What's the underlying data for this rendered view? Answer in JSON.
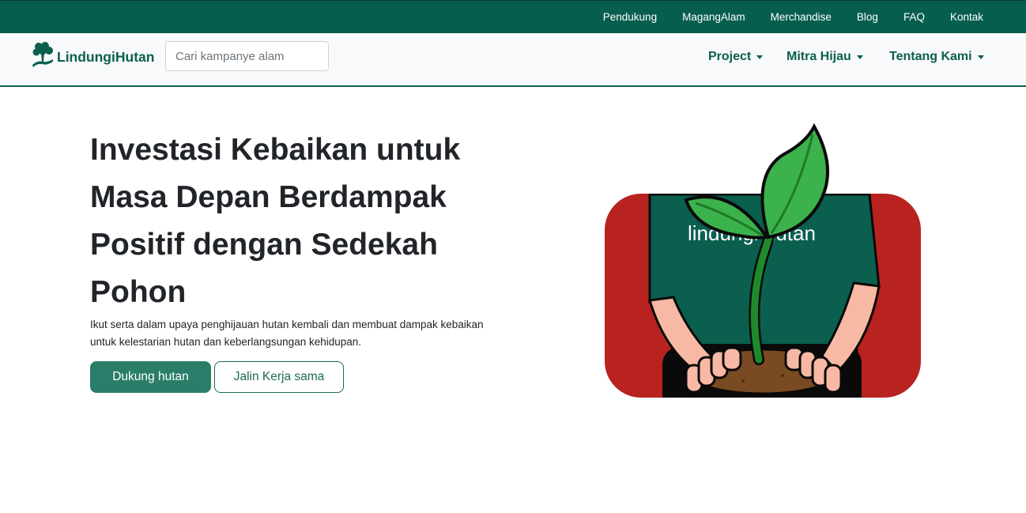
{
  "topbar": {
    "links": [
      "Pendukung",
      "MagangAlam",
      "Merchandise",
      "Blog",
      "FAQ",
      "Kontak"
    ]
  },
  "navbar": {
    "brand": "LindungiHutan",
    "search_placeholder": "Cari kampanye alam",
    "menu": [
      "Project",
      "Mitra Hijau",
      "Tentang Kami"
    ]
  },
  "hero": {
    "title_lines": [
      "Investasi Kebaikan untuk",
      "Masa Depan Berdampak",
      "Positif dengan Sedekah",
      "Pohon"
    ],
    "subtitle_lines": [
      "Ikut serta dalam upaya penghijauan hutan kembali dan membuat dampak kebaikan",
      "untuk kelestarian hutan dan keberlangsungan kehidupan."
    ],
    "primary_button": "Dukung hutan",
    "secondary_button": "Jalin Kerja sama"
  },
  "illustration": {
    "shirt_text": "lindungi hutan",
    "colors": {
      "background": "#b8221f",
      "shirt": "#0b5f4f",
      "leaf": "#3cb24c",
      "skin": "#f7b9a4",
      "soil": "#7a4a22"
    }
  },
  "colors": {
    "brand": "#075e4e",
    "accent": "#2a7d69"
  }
}
